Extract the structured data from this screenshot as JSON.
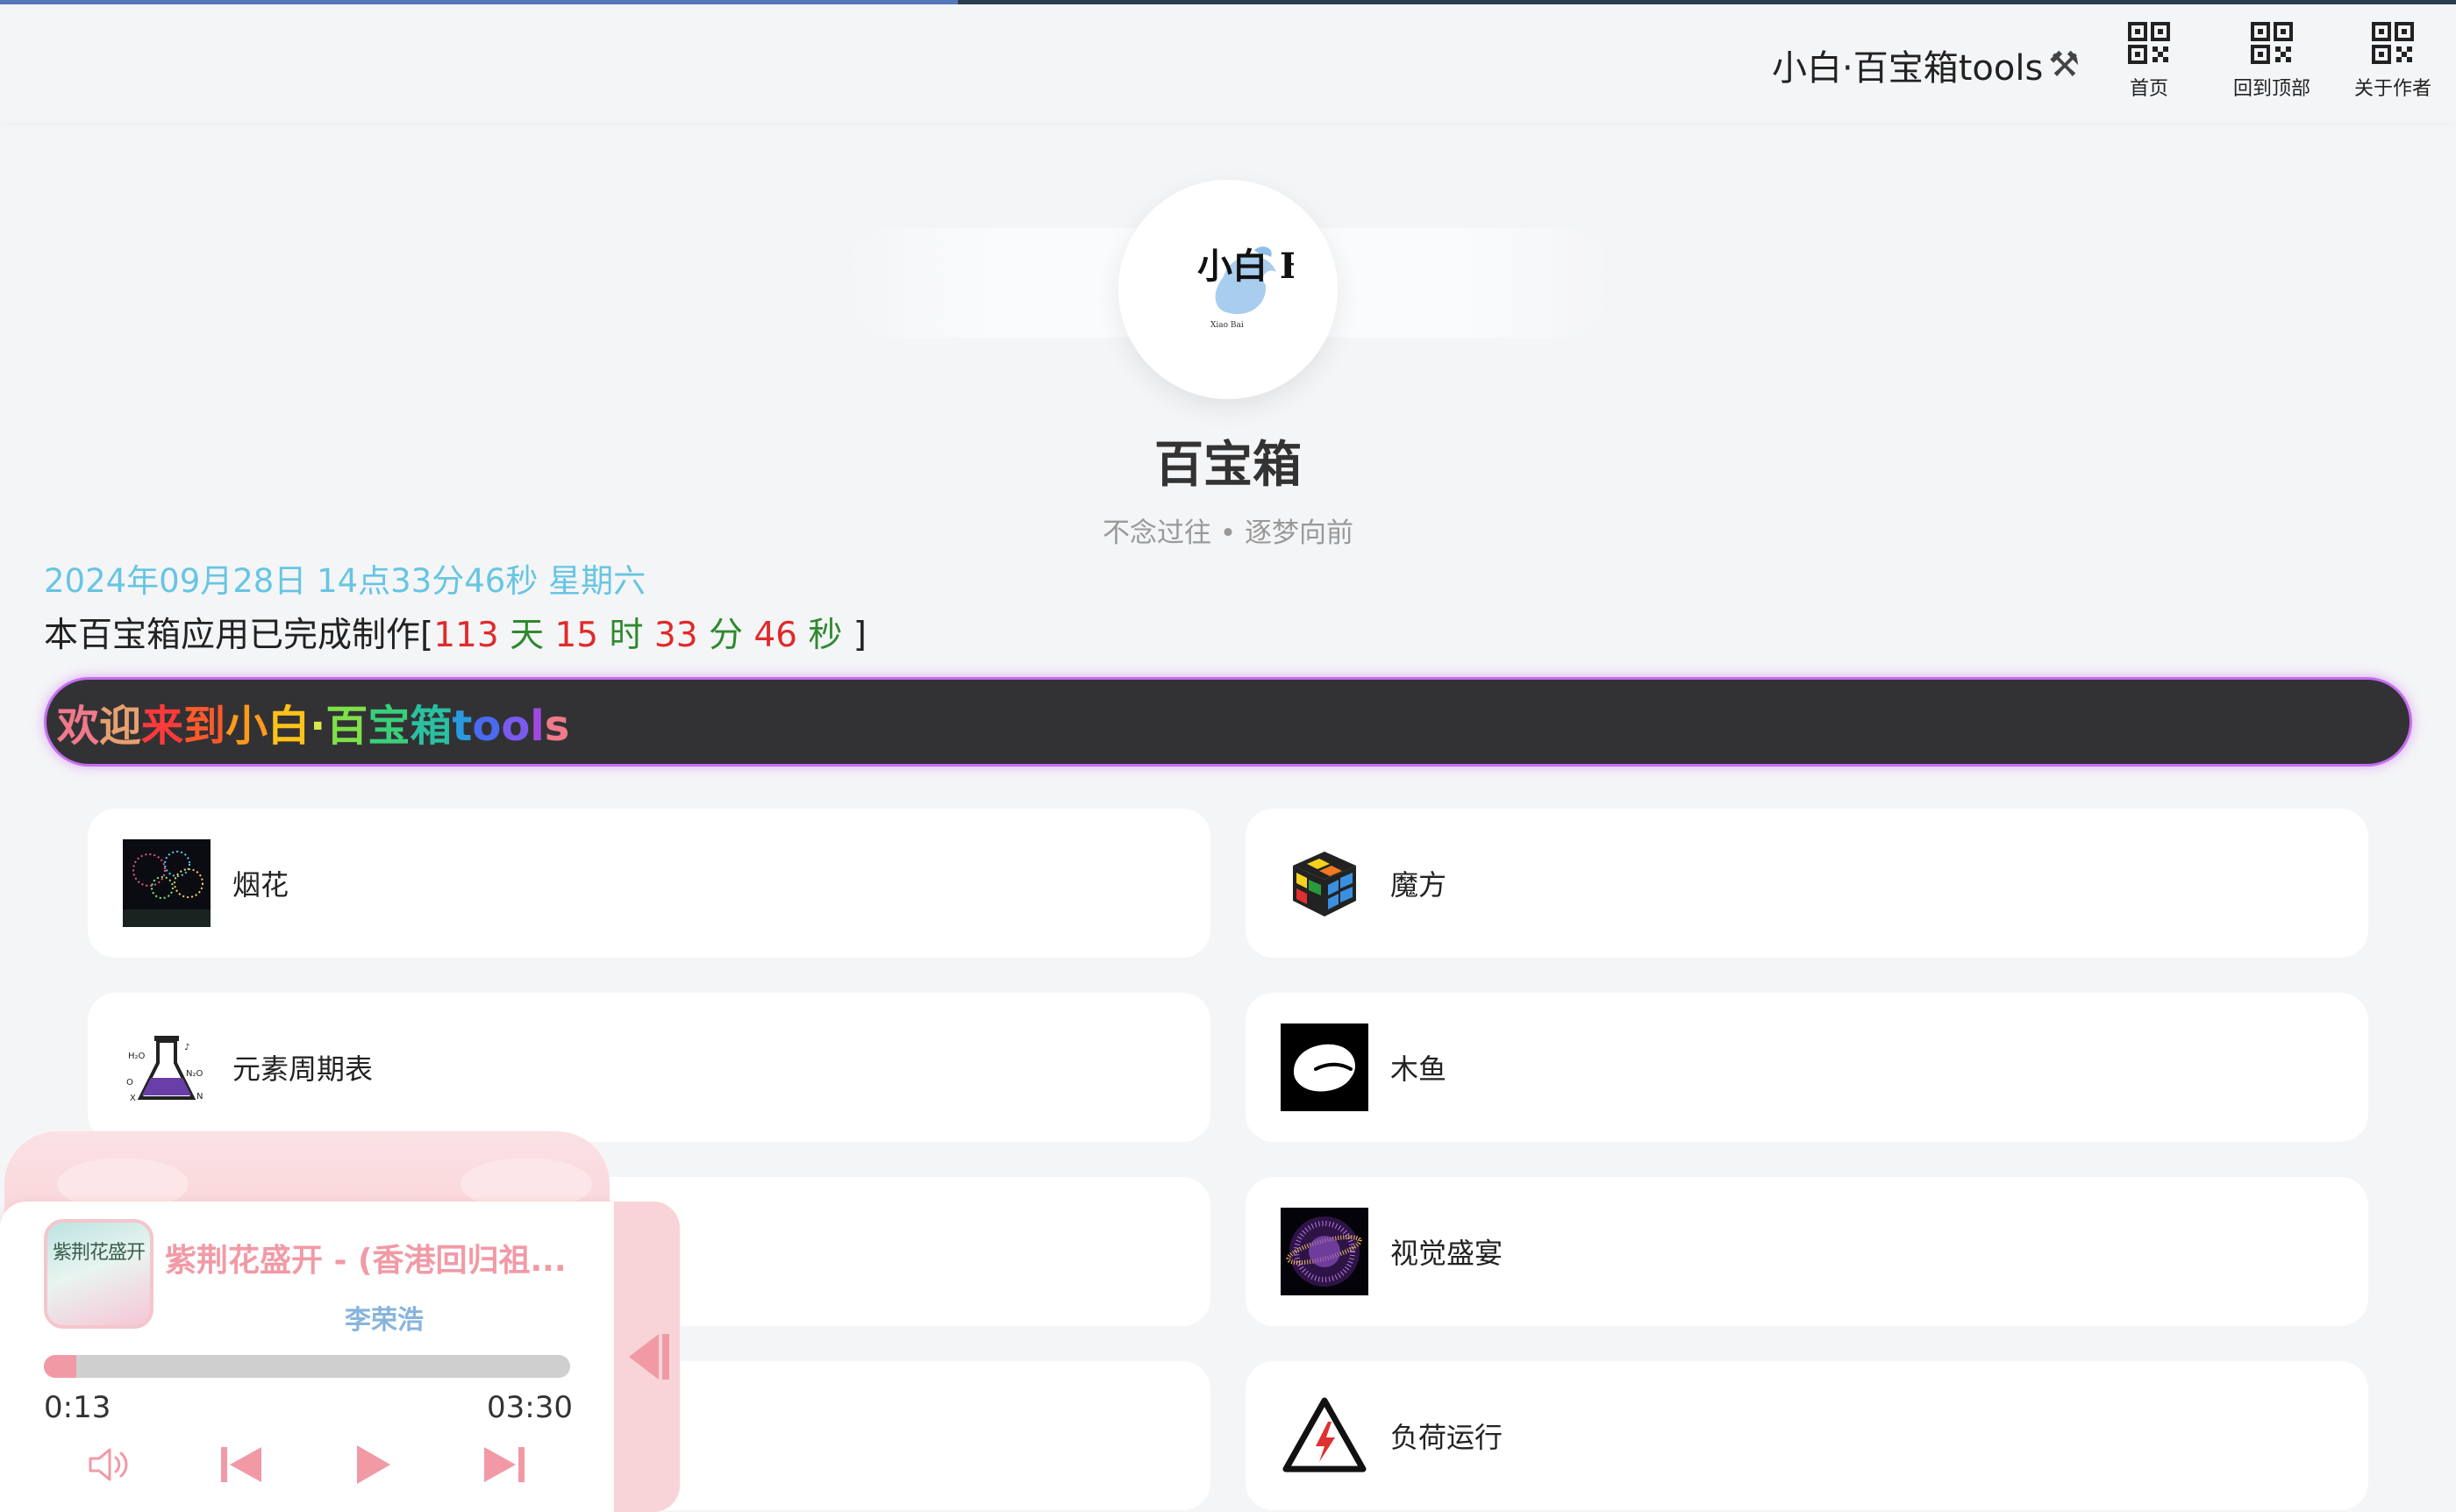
{
  "header": {
    "site_title": "小白·百宝箱tools",
    "load_progress": 0.39,
    "nav": [
      {
        "label": "首页",
        "icon": "qrcode-icon"
      },
      {
        "label": "回到顶部",
        "icon": "qrcode-icon"
      },
      {
        "label": "关于作者",
        "icon": "qrcode-icon"
      }
    ]
  },
  "profile": {
    "title": "百宝箱",
    "motto": "不念过往 • 逐梦向前",
    "logo_text": "小白 BB",
    "logo_caption": "Xiao Bai"
  },
  "clock": {
    "datetime": "2024年09月28日 14点33分46秒 星期六",
    "elapsed_prefix": "本百宝箱应用已完成制作[",
    "days": "113",
    "days_unit": " 天 ",
    "hours": "15",
    "hours_unit": " 时 ",
    "minutes": "33",
    "minutes_unit": " 分 ",
    "seconds": "46",
    "seconds_unit": " 秒 ",
    "elapsed_suffix": "]"
  },
  "banner": {
    "text": "欢迎来到小白·百宝箱tools"
  },
  "tools": [
    {
      "label": "烟花",
      "icon": "fireworks-icon"
    },
    {
      "label": "魔方",
      "icon": "rubiks-cube-icon"
    },
    {
      "label": "元素周期表",
      "icon": "chemistry-flask-icon"
    },
    {
      "label": "木鱼",
      "icon": "wooden-fish-icon"
    },
    {
      "label": "",
      "icon": ""
    },
    {
      "label": "视觉盛宴",
      "icon": "galaxy-icon"
    },
    {
      "label": "",
      "icon": ""
    },
    {
      "label": "负荷运行",
      "icon": "high-voltage-icon"
    }
  ],
  "player": {
    "song_title": "紫荆花盛开 - (香港回归祖...",
    "artist": "李荣浩",
    "cover_text": "紫荆花盛开",
    "current_time": "0:13",
    "total_time": "03:30",
    "progress": 0.062
  },
  "colors": {
    "accent_pink": "#f19aa6",
    "datetime_blue": "#67c5e3",
    "banner_bg": "#323235",
    "banner_glow": "#c56ef0"
  }
}
